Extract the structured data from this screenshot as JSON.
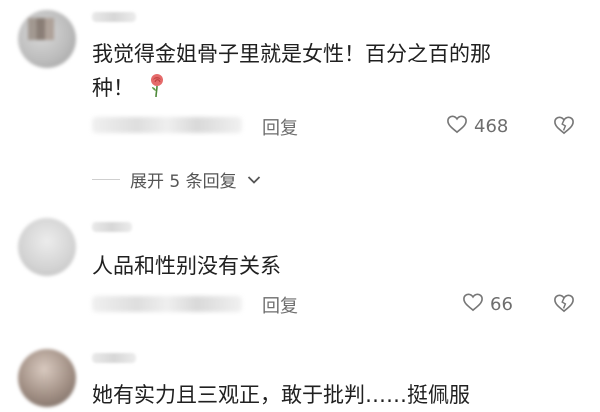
{
  "comments": [
    {
      "text_line1": "我觉得金姐骨子里就是女性！百分之百的那",
      "text_line2": "种！",
      "emoji": "rose-emoji",
      "reply_label": "回复",
      "like_count": "468"
    },
    {
      "text_line1": "人品和性别没有关系",
      "reply_label": "回复",
      "like_count": "66"
    },
    {
      "text_line1": "她有实力且三观正，敢于批判……挺佩服"
    }
  ],
  "expand_replies": {
    "label": "展开 5 条回复"
  },
  "icons": {
    "like": "heart-outline-icon",
    "dislike": "broken-heart-icon",
    "expand": "chevron-down-icon"
  },
  "colors": {
    "text": "#202020",
    "meta": "#6e6e6e",
    "background": "#ffffff"
  }
}
